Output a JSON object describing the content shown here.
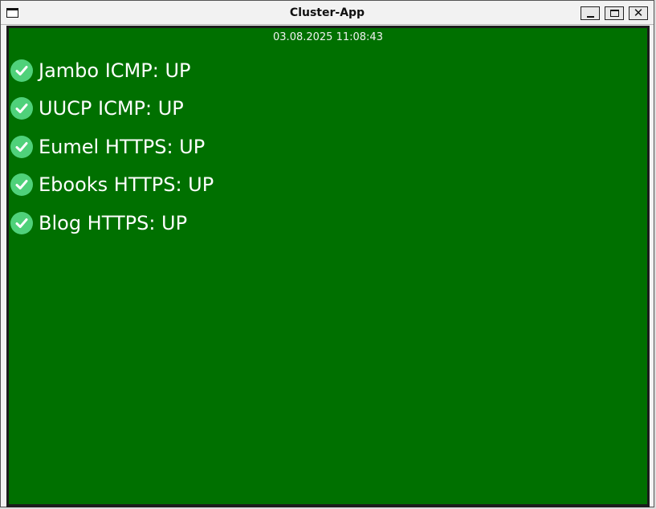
{
  "window": {
    "title": "Cluster-App"
  },
  "panel": {
    "timestamp": "03.08.2025 11:08:43",
    "background_color": "#007000",
    "check_color": "#4fd17a",
    "services": [
      {
        "label": "Jambo ICMP: UP",
        "icon": "check-circle-icon"
      },
      {
        "label": "UUCP ICMP: UP",
        "icon": "check-circle-icon"
      },
      {
        "label": "Eumel HTTPS: UP",
        "icon": "check-circle-icon"
      },
      {
        "label": "Ebooks HTTPS: UP",
        "icon": "check-circle-icon"
      },
      {
        "label": "Blog HTTPS: UP",
        "icon": "check-circle-icon"
      }
    ]
  }
}
